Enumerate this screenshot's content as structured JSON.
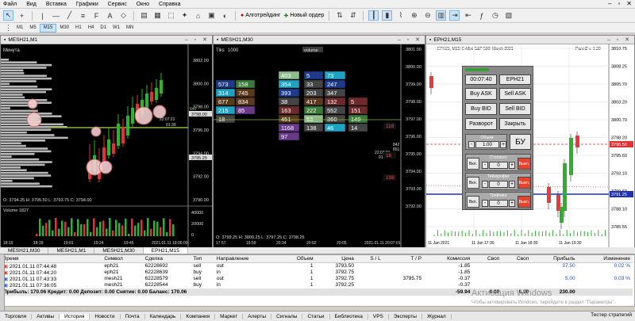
{
  "menu": [
    "Файл",
    "Вид",
    "Вставка",
    "Графики",
    "Сервис",
    "Окно",
    "Справка"
  ],
  "toolbar": {
    "algotrading": "Алготрейдинг",
    "new_order": "Новый ордер",
    "timeframes": [
      "M1",
      "M5",
      "M15",
      "M30",
      "H1",
      "H4",
      "D1",
      "W1",
      "MN"
    ],
    "active_timeframe": "M15"
  },
  "chart1": {
    "title": "MESH21,M1",
    "label_top": "Минута",
    "yticks": [
      "3802.00",
      "3800.00",
      "3798.00",
      "3796.00",
      "3794.00",
      "3792.00",
      "3790.00"
    ],
    "price_tags": [
      "842",
      "851",
      "3798.00",
      "3795.25"
    ],
    "time_tag": "22:07:21",
    "time_tag2": "01:39",
    "ohlc": "O: 3794.25  H: 3795.50  L: 3793.75  C: 3794.00",
    "volume_label": "Volume 1827",
    "vol_ticks": [
      "40000",
      "20000",
      "0"
    ],
    "xticks": [
      "18:15",
      "18:39",
      "19:01",
      "19:24",
      "19:45"
    ],
    "xdate": "2021.01.11 18:06:00"
  },
  "chart2": {
    "title": "MESH21,M30",
    "label_top": "Tiks",
    "tick_count": "1000",
    "volume_hdr": "volume",
    "yticks": [
      "3801.00",
      "3800.00",
      "3799.00",
      "3798.00",
      "3797.00",
      "3796.00",
      "3795.00",
      "3794.00",
      "3793.00",
      "3792.00"
    ],
    "tags": [
      "842",
      "851",
      "22:07:21",
      "01:39",
      "118",
      "16",
      "198"
    ],
    "cells": [
      {
        "v": "403",
        "c": "#8fbc8f",
        "r": 0,
        "col": 2
      },
      {
        "v": "5",
        "c": "#1e3a8a",
        "r": 0,
        "col": 3
      },
      {
        "v": "73",
        "c": "#1fa3c4",
        "r": 0,
        "col": 4
      },
      {
        "v": "573",
        "c": "#1e3a8a",
        "r": 1,
        "col": 0
      },
      {
        "v": "158",
        "c": "#3a7a3a",
        "r": 1,
        "col": 1
      },
      {
        "v": "354",
        "c": "#1fa3c4",
        "r": 1,
        "col": 2
      },
      {
        "v": "33",
        "c": "#444",
        "r": 1,
        "col": 3
      },
      {
        "v": "247",
        "c": "#1e3a8a",
        "r": 1,
        "col": 4
      },
      {
        "v": "314",
        "c": "#1fa3c4",
        "r": 2,
        "col": 0
      },
      {
        "v": "745",
        "c": "#5a3a1a",
        "r": 2,
        "col": 1
      },
      {
        "v": "393",
        "c": "#1e3a8a",
        "r": 2,
        "col": 2
      },
      {
        "v": "203",
        "c": "#444",
        "r": 2,
        "col": 3
      },
      {
        "v": "347",
        "c": "#444",
        "r": 2,
        "col": 4
      },
      {
        "v": "677",
        "c": "#5a3a1a",
        "r": 3,
        "col": 0
      },
      {
        "v": "834",
        "c": "#5a3a1a",
        "r": 3,
        "col": 1
      },
      {
        "v": "38",
        "c": "#444",
        "r": 3,
        "col": 2
      },
      {
        "v": "417",
        "c": "#5a3a1a",
        "r": 3,
        "col": 3
      },
      {
        "v": "132",
        "c": "#6e2a2a",
        "r": 3,
        "col": 4
      },
      {
        "v": "5",
        "c": "#6e2a2a",
        "r": 3,
        "col": 5
      },
      {
        "v": "215",
        "c": "#1fa3c4",
        "r": 4,
        "col": 0
      },
      {
        "v": "85",
        "c": "#6a3a8a",
        "r": 4,
        "col": 1
      },
      {
        "v": "163",
        "c": "#6e2a2a",
        "r": 4,
        "col": 2
      },
      {
        "v": "222",
        "c": "#3a7a3a",
        "r": 4,
        "col": 3
      },
      {
        "v": "552",
        "c": "#444",
        "r": 4,
        "col": 4
      },
      {
        "v": "151",
        "c": "#6e2a2a",
        "r": 4,
        "col": 5
      },
      {
        "v": "18",
        "c": "#444",
        "r": 5,
        "col": 0
      },
      {
        "v": "451",
        "c": "#5a3a1a",
        "r": 5,
        "col": 2
      },
      {
        "v": "53",
        "c": "#8fbc8f",
        "r": 5,
        "col": 3
      },
      {
        "v": "360",
        "c": "#444",
        "r": 5,
        "col": 4
      },
      {
        "v": "149",
        "c": "#3a7a3a",
        "r": 5,
        "col": 5
      },
      {
        "v": "1168",
        "c": "#6a3a8a",
        "r": 6,
        "col": 2
      },
      {
        "v": "138",
        "c": "#444",
        "r": 6,
        "col": 3
      },
      {
        "v": "46",
        "c": "#1fa3c4",
        "r": 6,
        "col": 4
      },
      {
        "v": "14",
        "c": "#444",
        "r": 6,
        "col": 5
      },
      {
        "v": "97",
        "c": "#6a3a8a",
        "r": 7,
        "col": 2
      }
    ],
    "ohlc": "O: 3799.25  H: 3800.25  L: 3797.25  C: 3798.25",
    "xticks": [
      "17:57",
      "19:59",
      "20:34",
      "20:02",
      "20:05"
    ],
    "xdate": "2021.01.11 20:07:01"
  },
  "chart3": {
    "title": "EPH21,M15",
    "subtitle": "EPH21, M15:  E-Mini S&P 500: March 2021",
    "subtitle_right": "Panel2 v. 1.30",
    "yticks": [
      "3810.75",
      "3808.25",
      "3805.70",
      "3803.20",
      "3800.70",
      "3798.20",
      "3795.60",
      "3793.10",
      "3790.60",
      "3788.10",
      "3785.55"
    ],
    "price_red": "3796.50",
    "price_blue": "3791.25",
    "xticks": [
      "11 Jan 2021",
      "11 Jan 17:30",
      "11 Jan 18:30",
      "11 Jan 19:30"
    ]
  },
  "panel": {
    "time": "00:07:40",
    "symbol": "EPH21",
    "buy_ask": "Buy ASK",
    "sell_ask": "Sell ASK",
    "buy_bid": "Buy BID",
    "sell_bid": "Sell BID",
    "reverse": "Разворот",
    "close": "Закрыть",
    "volume_label": "Объем",
    "volume_value": "1.00",
    "be": "БУ",
    "on": "Вкл.",
    "off": "Выкл.",
    "stoploss": "Стоплосс",
    "takeprofit": "Тейкпрофит",
    "trailing": "Трейлинг",
    "zero": "0",
    "minus": "-",
    "plus": "+"
  },
  "chart_tabs": [
    "MESH21,M30",
    "MESH21,M1",
    "MESH21,M30",
    "EPH21,M15"
  ],
  "active_chart_tab": 3,
  "history": {
    "headers": [
      "Время",
      "Символ",
      "Сделка",
      "Тип",
      "Направление",
      "Объем",
      "Цена",
      "S / L",
      "T / P",
      "Комиссия",
      "Своп",
      "Своп",
      "Прибыль",
      "Изменение"
    ],
    "rows": [
      {
        "time": "2021.01.11 07:44:48",
        "sym": "eph21",
        "deal": "62228692",
        "type": "sell",
        "dir": "out",
        "vol": "1",
        "price": "3793.50",
        "sl": "",
        "tp": "",
        "comm": "-1.85",
        "swap": "",
        "swap2": "",
        "profit": "37.50",
        "chg": "0.02 %",
        "color": "#d04020"
      },
      {
        "time": "2021.01.11 07:44:20",
        "sym": "eph21",
        "deal": "62228639",
        "type": "buy",
        "dir": "in",
        "vol": "1",
        "price": "3792.75",
        "sl": "",
        "tp": "",
        "comm": "-1.85",
        "swap": "",
        "swap2": "",
        "profit": "",
        "chg": "",
        "color": "#d04020"
      },
      {
        "time": "2021.01.11 07:43:33",
        "sym": "mesh21",
        "deal": "62228579",
        "type": "sell",
        "dir": "out",
        "vol": "1",
        "price": "3792.75",
        "sl": "",
        "tp": "3795.75",
        "comm": "-0.37",
        "swap": "",
        "swap2": "",
        "profit": "5.00",
        "chg": "0.03 %",
        "color": "#3060c0"
      },
      {
        "time": "2021.01.11 07:36:05",
        "sym": "mesh21",
        "deal": "62228544",
        "type": "buy",
        "dir": "in",
        "vol": "1",
        "price": "3792.25",
        "sl": "",
        "tp": "",
        "comm": "-0.37",
        "swap": "",
        "swap2": "",
        "profit": "",
        "chg": "",
        "color": "#3060c0"
      }
    ],
    "summary": "Прибыль: 170.06  Кредит: 0.00  Депозит: 0.00  Снятие: 0.00  Баланс: 170.06",
    "summary_comm": "-59.94",
    "summary_swap": "0.00",
    "summary_swap2": "0.00",
    "summary_profit": "230.00"
  },
  "watermark": "Активация Windows",
  "watermark2": "Чтобы активировать Windows, перейдите в раздел \"Параметры\".",
  "bottom_tabs": [
    "Торговля",
    "Активы",
    "История",
    "Новости",
    "Почта",
    "Календарь",
    "Компания",
    "Маркет",
    "Алерты",
    "Сигналы",
    "Статьи",
    "Библиотека",
    "VPS",
    "Эксперты",
    "Журнал"
  ],
  "active_bottom_tab": 2,
  "strategy_tester": "Тестер стратегий"
}
